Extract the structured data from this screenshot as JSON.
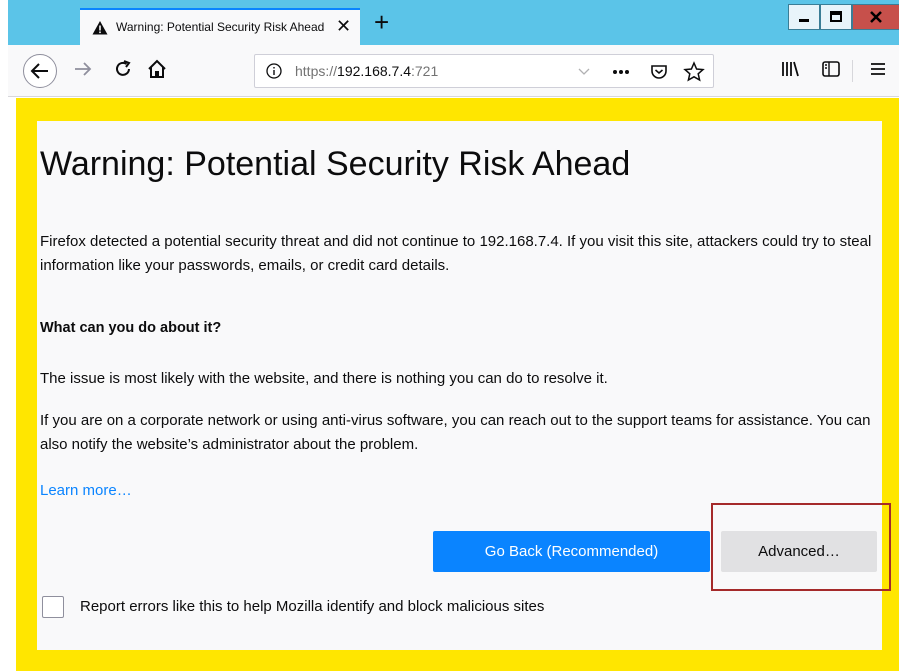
{
  "browser": {
    "tab_title": "Warning: Potential Security Risk Ahead",
    "tab_close": "✕",
    "new_tab": "+",
    "url_scheme": "https://",
    "url_host": "192.168.7.4",
    "url_port": ":721",
    "icons": [
      "back-arrow-icon",
      "forward-arrow-icon",
      "reload-icon",
      "home-icon",
      "info-icon",
      "dropdown-chevron-icon",
      "page-actions-icon",
      "pocket-icon",
      "bookmark-star-icon",
      "library-icon",
      "sidebar-icon",
      "menu-icon",
      "warning-icon",
      "minimize-icon",
      "maximize-icon",
      "close-icon"
    ]
  },
  "page": {
    "title": "Warning: Potential Security Risk Ahead",
    "intro": "Firefox detected a potential security threat and did not continue to 192.168.7.4. If you visit this site, attackers could try to steal information like your passwords, emails, or credit card details.",
    "subheading": "What can you do about it?",
    "para1": "The issue is most likely with the website, and there is nothing you can do to resolve it.",
    "para2": "If you are on a corporate network or using anti-virus software, you can reach out to the support teams for assistance. You can also notify the website’s administrator about the problem.",
    "learn_more": "Learn more…",
    "go_back_label": "Go Back (Recommended)",
    "advanced_label": "Advanced…",
    "report_label": "Report errors like this to help Mozilla identify and block malicious sites",
    "report_checked": false
  },
  "colors": {
    "accent_blue": "#0a84ff",
    "highlight_yellow": "#ffe600",
    "annotation_red": "#a52a2a",
    "titlebar": "#5bc4e8"
  }
}
